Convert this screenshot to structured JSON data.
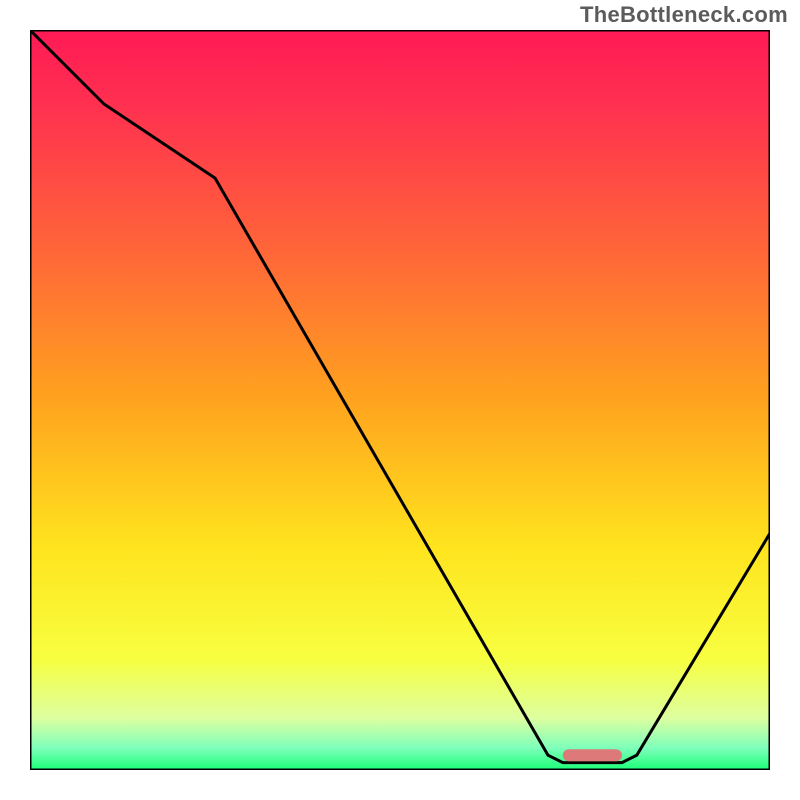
{
  "watermark": "TheBottleneck.com",
  "chart_data": {
    "type": "line",
    "title": "",
    "xlabel": "",
    "ylabel": "",
    "xlim": [
      0,
      100
    ],
    "ylim": [
      0,
      100
    ],
    "curve": {
      "name": "bottleneck-curve",
      "x": [
        0,
        10,
        25,
        70,
        72,
        80,
        82,
        100
      ],
      "y": [
        100,
        90,
        80,
        2,
        1,
        1,
        2,
        32
      ]
    },
    "marker": {
      "name": "optimal-point",
      "x_range": [
        72,
        80
      ],
      "y": 2,
      "color": "#dd7a79"
    },
    "gradient_stops": [
      {
        "pos": 0.0,
        "color": "#ff1a55"
      },
      {
        "pos": 0.1,
        "color": "#ff3050"
      },
      {
        "pos": 0.3,
        "color": "#ff6638"
      },
      {
        "pos": 0.5,
        "color": "#ffa31e"
      },
      {
        "pos": 0.7,
        "color": "#ffe41e"
      },
      {
        "pos": 0.85,
        "color": "#f7ff40"
      },
      {
        "pos": 0.93,
        "color": "#ddffa0"
      },
      {
        "pos": 0.97,
        "color": "#7fffbb"
      },
      {
        "pos": 1.0,
        "color": "#1bff77"
      }
    ],
    "border_color": "#000000",
    "curve_stroke": "#000000",
    "curve_stroke_width": 3
  }
}
